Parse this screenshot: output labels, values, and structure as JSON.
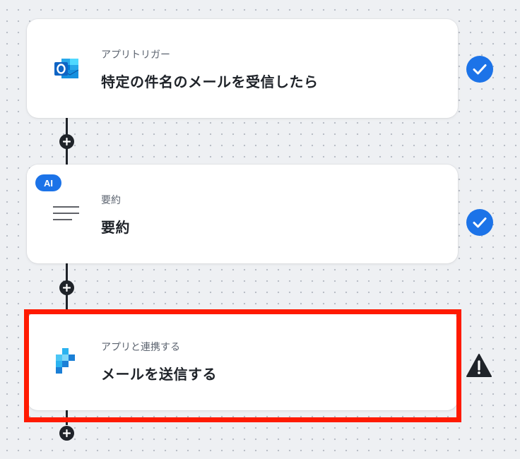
{
  "colors": {
    "connector": "#1f2329",
    "accent_blue": "#1c73e8",
    "highlight_red": "#ff1a00",
    "warning": "#1f2329"
  },
  "steps": [
    {
      "subtitle": "アプリトリガー",
      "title": "特定の件名のメールを受信したら",
      "icon": "outlook-icon",
      "status": "check-icon"
    },
    {
      "badge": "AI",
      "subtitle": "要約",
      "title": "要約",
      "icon": "summary-lines-icon",
      "status": "check-icon"
    },
    {
      "subtitle": "アプリと連携する",
      "title": "メールを送信する",
      "icon": "mail-app-icon",
      "status": "warning-icon"
    }
  ]
}
